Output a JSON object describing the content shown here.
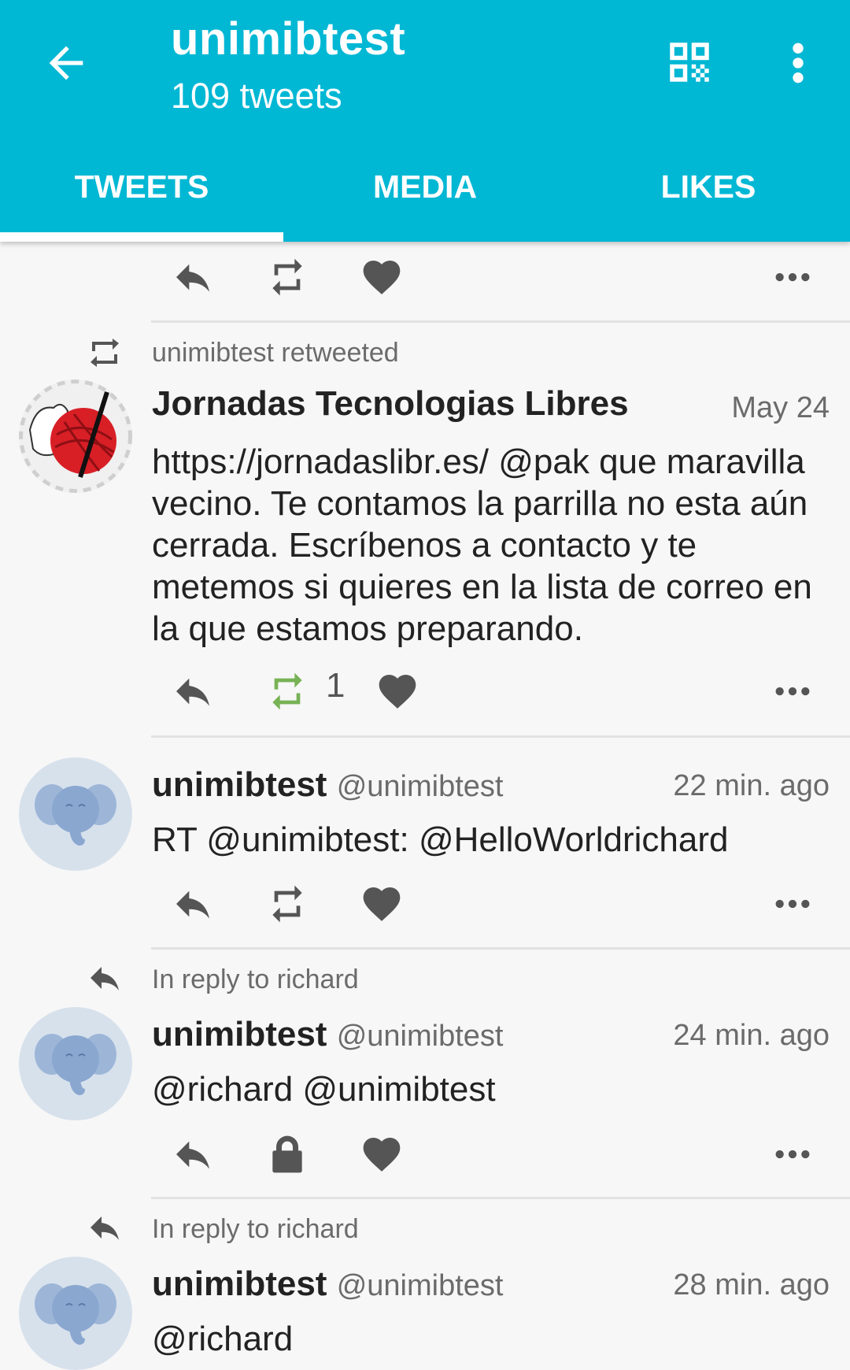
{
  "header": {
    "title": "unimibtest",
    "subtitle": "109 tweets",
    "back_icon": "arrow-left-icon",
    "qr_icon": "qr-code-icon",
    "overflow_icon": "more-vert-icon",
    "background": "#00b7d4"
  },
  "tabs": [
    {
      "label": "TWEETS",
      "selected": true
    },
    {
      "label": "MEDIA",
      "selected": false
    },
    {
      "label": "LIKES",
      "selected": false
    }
  ],
  "tweets": [
    {
      "context": "unimibtest retweeted",
      "name": "Jornadas Tecnologias Libres",
      "handle": "",
      "time": "May 24",
      "text": "https://jornadaslibr.es/ @pak que maravilla vecino. Te contamos la parrilla no esta aún cerrada. Escríbenos a contacto y te metemos si quieres en la lista de correo en la que estamos preparando.",
      "retweet_count": "1",
      "retweeted": true
    },
    {
      "context": "",
      "name": "unimibtest",
      "handle": "@unimibtest",
      "time": "22 min. ago",
      "text": "RT @unimibtest: @HelloWorldrichard"
    },
    {
      "context": "In reply to richard",
      "name": "unimibtest",
      "handle": "@unimibtest",
      "time": "24 min. ago",
      "text": "@richard @unimibtest",
      "locked": true
    },
    {
      "context": "In reply to richard",
      "name": "unimibtest",
      "handle": "@unimibtest",
      "time": "28 min. ago",
      "text": "@richard"
    }
  ],
  "colors": {
    "accent": "#00b7d4",
    "retweet_active": "#77b255",
    "icon": "#555555"
  }
}
